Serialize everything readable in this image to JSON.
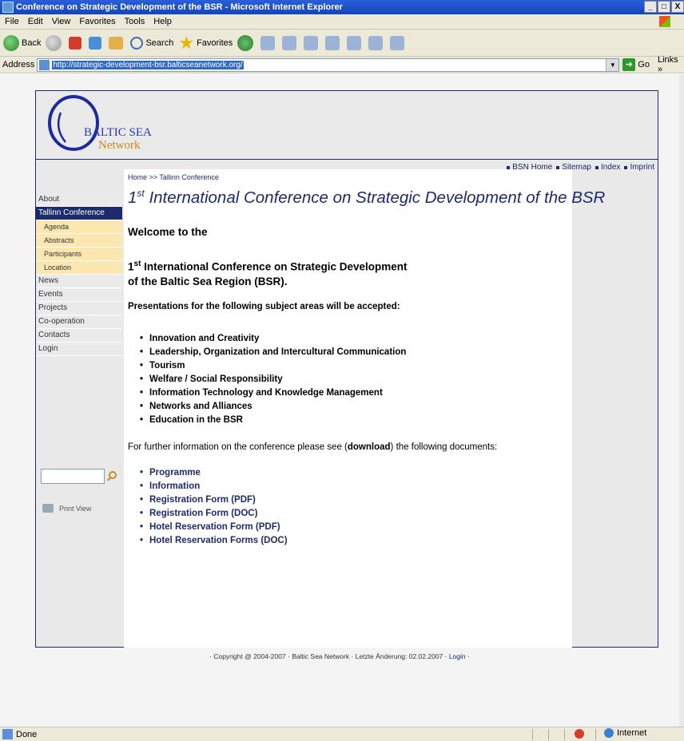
{
  "window": {
    "title": "Conference on Strategic Development of the BSR - Microsoft Internet Explorer",
    "btn_min": "_",
    "btn_max": "□",
    "btn_close": "X"
  },
  "menubar": {
    "items": [
      "File",
      "Edit",
      "View",
      "Favorites",
      "Tools",
      "Help"
    ]
  },
  "toolbar": {
    "back": "Back",
    "search": "Search",
    "favorites": "Favorites",
    "fav_star": "★"
  },
  "addressbar": {
    "label": "Address",
    "url": "http://strategic-development-bsr.balticseanetwork.org/",
    "dropdown": "▼",
    "go_arrow": "➜",
    "go": "Go",
    "links": "Links »"
  },
  "site": {
    "logo": {
      "line1": "BALTIC SEA",
      "line2": "Network"
    },
    "topnav": [
      "BSN Home",
      "Sitemap",
      "Index",
      "Imprint"
    ],
    "sidebar": {
      "items": [
        {
          "label": "About",
          "type": "item"
        },
        {
          "label": "Tallinn Conference",
          "type": "active"
        },
        {
          "label": "Agenda",
          "type": "sub"
        },
        {
          "label": "Abstracts",
          "type": "sub"
        },
        {
          "label": "Participants",
          "type": "sub"
        },
        {
          "label": "Location",
          "type": "sub"
        },
        {
          "label": "News",
          "type": "item"
        },
        {
          "label": "Events",
          "type": "item"
        },
        {
          "label": "Projects",
          "type": "item"
        },
        {
          "label": "Co-operation",
          "type": "item"
        },
        {
          "label": "Contacts",
          "type": "item"
        },
        {
          "label": "Login",
          "type": "item"
        }
      ],
      "print_view": "Print View"
    },
    "content": {
      "breadcrumb": "Home >> Tallinn Conference",
      "headline_num": "1",
      "headline_sup": "st",
      "headline_rest": " International Conference on Strategic Development of the BSR",
      "welcome": "Welcome to the",
      "conf_num": "1",
      "conf_sup": "st",
      "conf_line1": " International Conference on Strategic Development",
      "conf_line2": "of the Baltic Sea Region (BSR).",
      "intro": "Presentations for the following subject areas will be accepted:",
      "subjects": [
        "Innovation and Creativity",
        "Leadership, Organization and Intercultural Communication",
        "Tourism",
        "Welfare / Social Responsibility",
        "Information Technology and Knowledge Management",
        "Networks and Alliances",
        "Education in the BSR"
      ],
      "further_pre": "For further information on the conference please see (",
      "further_bold": "download",
      "further_post": ") the following documents:",
      "documents": [
        "Programme",
        "Information",
        "Registration Form (PDF)",
        "Registration Form (DOC)",
        "Hotel Reservation Form (PDF)",
        "Hotel Reservation Forms (DOC)"
      ]
    },
    "footer": {
      "text": "· Copyright @ 2004-2007 · Baltic Sea Network · Letzte Änderung: 02.02.2007 · ",
      "login": "Login",
      "tail": " ·"
    }
  },
  "status": {
    "text": "Done",
    "zone": "Internet"
  }
}
